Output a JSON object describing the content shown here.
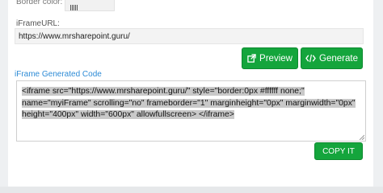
{
  "border_color": {
    "label": "Border color:"
  },
  "iframe_url": {
    "label": "iFrameURL:",
    "value": "https://www.mrsharepoint.guru/"
  },
  "buttons": {
    "preview": "Preview",
    "generate": "Generate",
    "copy": "COPY IT"
  },
  "code": {
    "label": "iFrame Generated Code",
    "lines": [
      "<iframe src=\"https://www.mrsharepoint.guru/\" style=\"border:0px #ffffff none;\"",
      "name=\"myiFrame\" scrolling=\"no\" frameborder=\"1\" marginheight=\"0px\" marginwidth=\"0px\"",
      "height=\"400px\" width=\"600px\" allowfullscreen> </iframe>"
    ]
  },
  "colors": {
    "accent_green": "#14a53c",
    "label_blue": "#2d8bd6"
  }
}
